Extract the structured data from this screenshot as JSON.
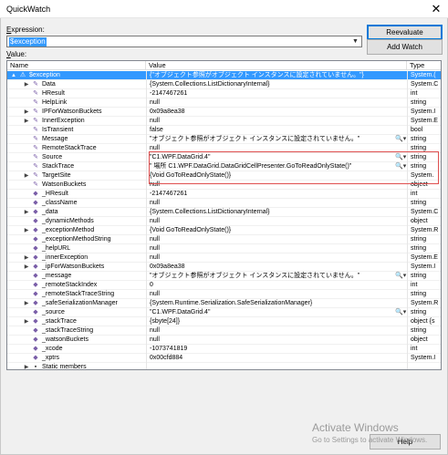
{
  "window": {
    "title": "QuickWatch",
    "close": "✕"
  },
  "expression": {
    "label_u": "E",
    "label_rest": "xpression:",
    "value": "$exception"
  },
  "buttons": {
    "reevaluate": "Reevaluate",
    "add_watch": "Add Watch",
    "help": "Help"
  },
  "value_label": {
    "label_u": "V",
    "label_rest": "alue:"
  },
  "columns": {
    "name": "Name",
    "value": "Value",
    "type": "Type"
  },
  "rows": [
    {
      "name": "$exception",
      "value": "{\"オブジェクト参照がオブジェクト インスタンスに設定されていません。\"}",
      "type": "System.(",
      "exp": "▲",
      "icon": "ex"
    },
    {
      "name": "Data",
      "value": "{System.Collections.ListDictionaryInternal}",
      "type": "System.C",
      "exp": "▶",
      "icon": "w"
    },
    {
      "name": "HResult",
      "value": "-2147467261",
      "type": "int",
      "exp": "",
      "icon": "w"
    },
    {
      "name": "HelpLink",
      "value": "null",
      "type": "string",
      "exp": "",
      "icon": "w"
    },
    {
      "name": "IPForWatsonBuckets",
      "value": "0x09a8ea38",
      "type": "System.I",
      "exp": "▶",
      "icon": "w"
    },
    {
      "name": "InnerException",
      "value": "null",
      "type": "System.E",
      "exp": "▶",
      "icon": "w"
    },
    {
      "name": "IsTransient",
      "value": "false",
      "type": "bool",
      "exp": "",
      "icon": "w"
    },
    {
      "name": "Message",
      "value": "\"オブジェクト参照がオブジェクト インスタンスに設定されていません。\"",
      "type": "string",
      "exp": "",
      "icon": "w",
      "mag": true
    },
    {
      "name": "RemoteStackTrace",
      "value": "null",
      "type": "string",
      "exp": "",
      "icon": "w"
    },
    {
      "name": "Source",
      "value": "\"C1.WPF.DataGrid.4\"",
      "type": "string",
      "exp": "",
      "icon": "w",
      "mag": true
    },
    {
      "name": "StackTrace",
      "value": "\"   場所 C1.WPF.DataGrid.DataGridCellPresenter.GoToReadOnlyState()\"",
      "type": "string",
      "exp": "",
      "icon": "w",
      "mag": true
    },
    {
      "name": "TargetSite",
      "value": "{Void GoToReadOnlyState()}",
      "type": "System.",
      "exp": "▶",
      "icon": "w"
    },
    {
      "name": "WatsonBuckets",
      "value": "null",
      "type": "object",
      "exp": "",
      "icon": "w"
    },
    {
      "name": "_HResult",
      "value": "-2147467261",
      "type": "int",
      "exp": "",
      "icon": "f"
    },
    {
      "name": "_className",
      "value": "null",
      "type": "string",
      "exp": "",
      "icon": "f"
    },
    {
      "name": "_data",
      "value": "{System.Collections.ListDictionaryInternal}",
      "type": "System.C",
      "exp": "▶",
      "icon": "f"
    },
    {
      "name": "_dynamicMethods",
      "value": "null",
      "type": "object",
      "exp": "",
      "icon": "f"
    },
    {
      "name": "_exceptionMethod",
      "value": "{Void GoToReadOnlyState()}",
      "type": "System.R",
      "exp": "▶",
      "icon": "f"
    },
    {
      "name": "_exceptionMethodString",
      "value": "null",
      "type": "string",
      "exp": "",
      "icon": "f"
    },
    {
      "name": "_helpURL",
      "value": "null",
      "type": "string",
      "exp": "",
      "icon": "f"
    },
    {
      "name": "_innerException",
      "value": "null",
      "type": "System.E",
      "exp": "▶",
      "icon": "f"
    },
    {
      "name": "_ipForWatsonBuckets",
      "value": "0x09a8ea38",
      "type": "System.I",
      "exp": "▶",
      "icon": "f"
    },
    {
      "name": "_message",
      "value": "\"オブジェクト参照がオブジェクト インスタンスに設定されていません。\"",
      "type": "string",
      "exp": "",
      "icon": "f",
      "mag": true
    },
    {
      "name": "_remoteStackIndex",
      "value": "0",
      "type": "int",
      "exp": "",
      "icon": "f"
    },
    {
      "name": "_remoteStackTraceString",
      "value": "null",
      "type": "string",
      "exp": "",
      "icon": "f"
    },
    {
      "name": "_safeSerializationManager",
      "value": "{System.Runtime.Serialization.SafeSerializationManager}",
      "type": "System.R",
      "exp": "▶",
      "icon": "f"
    },
    {
      "name": "_source",
      "value": "\"C1.WPF.DataGrid.4\"",
      "type": "string",
      "exp": "",
      "icon": "f",
      "mag": true
    },
    {
      "name": "_stackTrace",
      "value": "{sbyte[24]}",
      "type": "object {s",
      "exp": "▶",
      "icon": "f"
    },
    {
      "name": "_stackTraceString",
      "value": "null",
      "type": "string",
      "exp": "",
      "icon": "f"
    },
    {
      "name": "_watsonBuckets",
      "value": "null",
      "type": "object",
      "exp": "",
      "icon": "f"
    },
    {
      "name": "_xcode",
      "value": "-1073741819",
      "type": "int",
      "exp": "",
      "icon": "f"
    },
    {
      "name": "_xptrs",
      "value": "0x00cfd884",
      "type": "System.I",
      "exp": "",
      "icon": "f"
    },
    {
      "name": "Static members",
      "value": "",
      "type": "",
      "exp": "▶",
      "icon": "s"
    }
  ],
  "watermark": {
    "line1": "Activate Windows",
    "line2": "Go to Settings to activate Windows."
  }
}
